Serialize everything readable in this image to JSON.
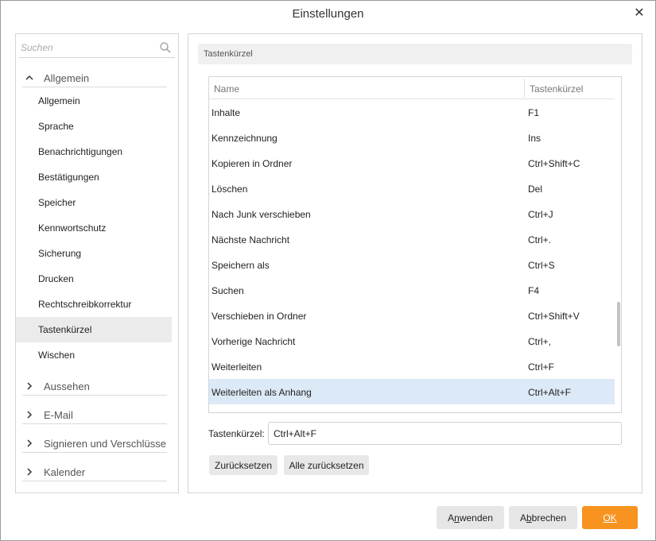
{
  "window": {
    "title": "Einstellungen",
    "close_label": "✕"
  },
  "search": {
    "placeholder": "Suchen"
  },
  "sidebar": {
    "groups": [
      {
        "label": "Allgemein",
        "expanded": true,
        "chevron": "^"
      },
      {
        "label": "Aussehen",
        "expanded": false,
        "chevron": ">"
      },
      {
        "label": "E-Mail",
        "expanded": false,
        "chevron": ">"
      },
      {
        "label": "Signieren und Verschlüsse",
        "expanded": false,
        "chevron": ">"
      },
      {
        "label": "Kalender",
        "expanded": false,
        "chevron": ">"
      }
    ],
    "items": [
      {
        "label": "Allgemein"
      },
      {
        "label": "Sprache"
      },
      {
        "label": "Benachrichtigungen"
      },
      {
        "label": "Bestätigungen"
      },
      {
        "label": "Speicher"
      },
      {
        "label": "Kennwortschutz"
      },
      {
        "label": "Sicherung"
      },
      {
        "label": "Drucken"
      },
      {
        "label": "Rechtschreibkorrektur"
      },
      {
        "label": "Tastenkürzel",
        "selected": true
      },
      {
        "label": "Wischen"
      }
    ]
  },
  "panel": {
    "section_title": "Tastenkürzel",
    "table": {
      "headers": {
        "name": "Name",
        "shortcut": "Tastenkürzel"
      },
      "rows": [
        {
          "name": "Inhalte",
          "shortcut": "F1"
        },
        {
          "name": "Kennzeichnung",
          "shortcut": "Ins"
        },
        {
          "name": "Kopieren in Ordner",
          "shortcut": "Ctrl+Shift+C"
        },
        {
          "name": "Löschen",
          "shortcut": "Del"
        },
        {
          "name": "Nach Junk verschieben",
          "shortcut": "Ctrl+J"
        },
        {
          "name": "Nächste Nachricht",
          "shortcut": "Ctrl+."
        },
        {
          "name": "Speichern als",
          "shortcut": "Ctrl+S"
        },
        {
          "name": "Suchen",
          "shortcut": "F4"
        },
        {
          "name": "Verschieben in Ordner",
          "shortcut": "Ctrl+Shift+V"
        },
        {
          "name": "Vorherige Nachricht",
          "shortcut": "Ctrl+,"
        },
        {
          "name": "Weiterleiten",
          "shortcut": "Ctrl+F"
        },
        {
          "name": "Weiterleiten als Anhang",
          "shortcut": "Ctrl+Alt+F",
          "selected": true
        }
      ]
    },
    "shortcut_label": "Tastenkürzel:",
    "shortcut_value": "Ctrl+Alt+F",
    "reset_label": "Zurücksetzen",
    "reset_all_label": "Alle zurücksetzen"
  },
  "footer": {
    "apply_label": "Anwenden",
    "apply_accesskey": "n",
    "cancel_label": "Abbrechen",
    "cancel_accesskey": "b",
    "ok_label": "OK"
  },
  "colors": {
    "accent": "#f7931e",
    "selection": "#dce9f7",
    "nav_selection": "#ebebeb"
  },
  "icons": {
    "search": "search-icon",
    "close": "close-icon",
    "expand": "chevron-up-icon",
    "collapse": "chevron-right-icon"
  }
}
